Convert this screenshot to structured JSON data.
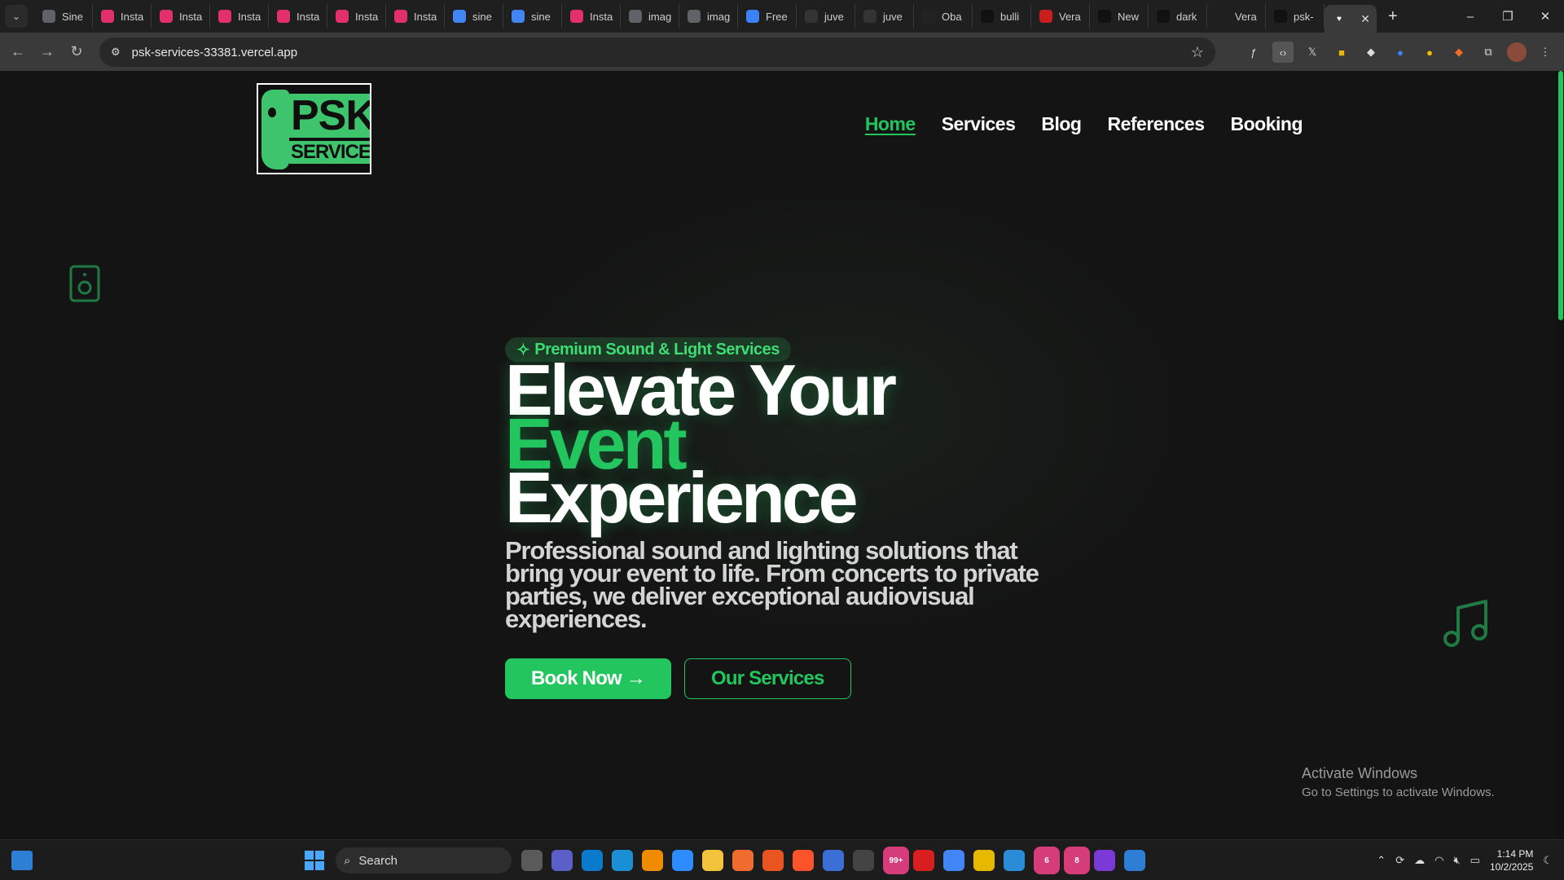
{
  "browser": {
    "tabs": [
      {
        "label": "Sine",
        "icon": "globe-icon",
        "color": "#5f6368"
      },
      {
        "label": "Insta",
        "icon": "instagram-icon",
        "color": "#e1306c"
      },
      {
        "label": "Insta",
        "icon": "instagram-icon",
        "color": "#e1306c"
      },
      {
        "label": "Insta",
        "icon": "instagram-icon",
        "color": "#e1306c"
      },
      {
        "label": "Insta",
        "icon": "instagram-icon",
        "color": "#e1306c"
      },
      {
        "label": "Insta",
        "icon": "instagram-icon",
        "color": "#e1306c"
      },
      {
        "label": "Insta",
        "icon": "instagram-icon",
        "color": "#e1306c"
      },
      {
        "label": "sine",
        "icon": "google-icon",
        "color": "#4285f4"
      },
      {
        "label": "sine",
        "icon": "google-icon",
        "color": "#4285f4"
      },
      {
        "label": "Insta",
        "icon": "instagram-icon",
        "color": "#e1306c"
      },
      {
        "label": "imag",
        "icon": "globe-icon",
        "color": "#5f6368"
      },
      {
        "label": "imag",
        "icon": "globe-icon",
        "color": "#5f6368"
      },
      {
        "label": "Free",
        "icon": "forms-icon",
        "color": "#3b82f6"
      },
      {
        "label": "juve",
        "icon": "github-icon",
        "color": "#333333"
      },
      {
        "label": "juve",
        "icon": "github-icon",
        "color": "#333333"
      },
      {
        "label": "Oba",
        "icon": "ss-icon",
        "color": "#222222"
      },
      {
        "label": "bulli",
        "icon": "triangle-icon",
        "color": "#111111"
      },
      {
        "label": "Vera",
        "icon": "vera-icon",
        "color": "#c81e1e"
      },
      {
        "label": "New",
        "icon": "triangle-icon",
        "color": "#111111"
      },
      {
        "label": "dark",
        "icon": "triangle-icon",
        "color": "#111111"
      },
      {
        "label": "Vera",
        "icon": "blank-icon",
        "color": "#1f1f1f"
      },
      {
        "label": "psk-",
        "icon": "triangle-icon",
        "color": "#111111"
      }
    ],
    "active_tab_icon": "heart-icon",
    "url": "psk-services-33381.vercel.app"
  },
  "site": {
    "logo_top": "PSK",
    "logo_bottom": "SERVICES",
    "nav": [
      "Home",
      "Services",
      "Blog",
      "References",
      "Booking"
    ],
    "active_nav": "Home",
    "accent_color": "#22c55e"
  },
  "hero": {
    "badge_icon": "sparkle-icon",
    "badge": "Premium Sound & Light Services",
    "headline_part1": "Elevate Your ",
    "headline_accent": "Event",
    "headline_part2": "Experience",
    "subheadline": "Professional sound and lighting solutions that bring your event to life. From concerts to private parties, we deliver exceptional audiovisual experiences.",
    "primary_cta": "Book Now →",
    "secondary_cta": "Our Services"
  },
  "watermark": {
    "title": "Activate Windows",
    "subtitle": "Go to Settings to activate Windows."
  },
  "taskbar": {
    "search_label": "Search",
    "apps": [
      {
        "name": "task-view",
        "color": "#5a5a5a",
        "badge": ""
      },
      {
        "name": "teams",
        "color": "#5b5fc7",
        "badge": ""
      },
      {
        "name": "vscode",
        "color": "#0a7acc",
        "badge": ""
      },
      {
        "name": "edge",
        "color": "#1a8fd6",
        "badge": ""
      },
      {
        "name": "vlc",
        "color": "#f08a00",
        "badge": ""
      },
      {
        "name": "zoom",
        "color": "#2d8cff",
        "badge": ""
      },
      {
        "name": "file-explorer",
        "color": "#f3c43b",
        "badge": ""
      },
      {
        "name": "postman",
        "color": "#ef6c2e",
        "badge": ""
      },
      {
        "name": "ubuntu",
        "color": "#e95420",
        "badge": ""
      },
      {
        "name": "brave",
        "color": "#fb542b",
        "badge": ""
      },
      {
        "name": "app",
        "color": "#3a6fd8",
        "badge": ""
      },
      {
        "name": "media-player",
        "color": "#444444",
        "badge": ""
      },
      {
        "name": "whatsapp",
        "color": "#25d366",
        "badge": "99+"
      },
      {
        "name": "flash",
        "color": "#d81e1e",
        "badge": ""
      },
      {
        "name": "chrome",
        "color": "#4285f4",
        "badge": ""
      },
      {
        "name": "app-yellow",
        "color": "#e6b800",
        "badge": ""
      },
      {
        "name": "remote-desktop",
        "color": "#2a8bd6",
        "badge": ""
      },
      {
        "name": "chrome-profile",
        "color": "#4285f4",
        "badge": "6"
      },
      {
        "name": "chrome-profile-2",
        "color": "#4285f4",
        "badge": "8"
      },
      {
        "name": "app-flag",
        "color": "#7b3ad8",
        "badge": ""
      },
      {
        "name": "app-blue",
        "color": "#2d7fd6",
        "badge": ""
      }
    ],
    "time": "1:14 PM",
    "date": "10/2/2025"
  }
}
